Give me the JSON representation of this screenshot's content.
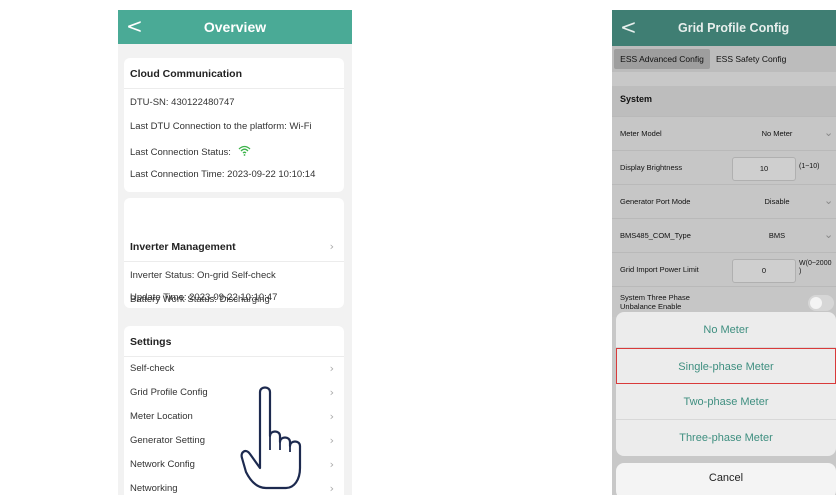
{
  "overview": {
    "title": "Overview",
    "back_glyph": "<",
    "cloud": {
      "title": "Cloud Communication",
      "dtu_sn": "DTU-SN:  430122480747",
      "last_conn_platform": "Last DTU Connection to the platform:  Wi-Fi",
      "last_conn_status": "Last Connection Status:",
      "last_conn_time": "Last Connection Time:  2023-09-22 10:10:14",
      "status_icon": "wifi-icon"
    },
    "inverter": {
      "title": "Inverter Management",
      "status": "Inverter Status:  On-grid Self-check",
      "battery": "Battery Work Status:  Discharging",
      "update": "Update Time:  2023-09-22 10:10:47"
    },
    "settings": {
      "title": "Settings",
      "items": [
        {
          "label": "Self-check"
        },
        {
          "label": "Grid Profile Config"
        },
        {
          "label": "Meter Location"
        },
        {
          "label": "Generator Setting"
        },
        {
          "label": "Network Config"
        },
        {
          "label": "Networking"
        }
      ]
    },
    "accent_color": "#4aaa96",
    "hand_icon": "pointing-hand-icon"
  },
  "grid_profile": {
    "title": "Grid Profile Config",
    "back_glyph": "<",
    "tabs": [
      {
        "label": "ESS Advanced Config"
      },
      {
        "label": "ESS Safety Config"
      }
    ],
    "section": "System",
    "rows": {
      "meter_model": {
        "label": "Meter Model",
        "value": "No Meter"
      },
      "display_brightness": {
        "label": "Display Brightness",
        "value": "10",
        "unit": "(1~10)"
      },
      "generator_port_mode": {
        "label": "Generator Port Mode",
        "value": "Disable"
      },
      "bms485": {
        "label": "BMS485_COM_Type",
        "value": "BMS"
      },
      "grid_import": {
        "label": "Grid Import Power Limit",
        "value": "0",
        "unit": "W(0~2000\n)"
      },
      "three_phase": {
        "label": "System Three Phase Unbalance Enable",
        "enabled": false
      }
    },
    "sheet": {
      "options": [
        {
          "label": "No Meter"
        },
        {
          "label": "Single-phase Meter"
        },
        {
          "label": "Two-phase Meter"
        },
        {
          "label": "Three-phase Meter"
        }
      ],
      "selected": "Single-phase Meter",
      "cancel": "Cancel"
    },
    "highlight_color": "#d93a3a"
  }
}
